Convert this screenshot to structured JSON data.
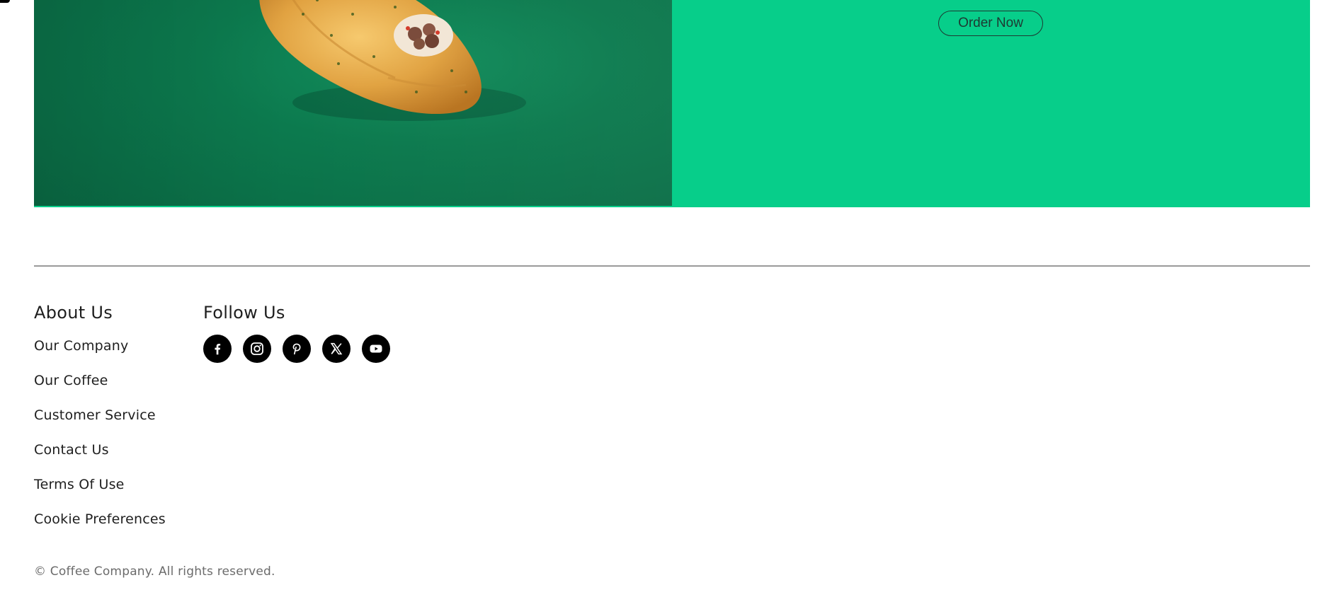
{
  "promo": {
    "order_button_label": "Order Now",
    "image_alt": "pastry-image",
    "colors": {
      "panel": "#07ce8a",
      "image_bg": "#0c7a4e"
    }
  },
  "footer": {
    "about": {
      "heading": "About Us",
      "links": [
        "Our Company",
        "Our Coffee",
        "Customer Service",
        "Contact Us",
        "Terms Of Use",
        "Cookie Preferences"
      ]
    },
    "follow": {
      "heading": "Follow Us",
      "icons": [
        "facebook-icon",
        "instagram-icon",
        "pinterest-icon",
        "x-icon",
        "youtube-icon"
      ]
    },
    "copyright": "© Coffee Company. All rights reserved."
  }
}
